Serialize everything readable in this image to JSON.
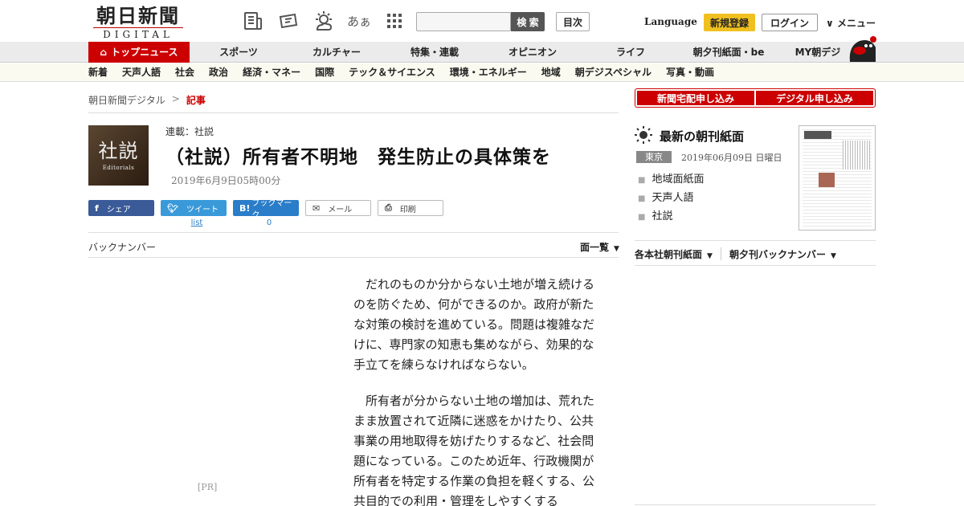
{
  "header": {
    "logo_main": "朝日新聞",
    "logo_sub": "DIGITAL",
    "search_label": "検 索",
    "toc_label": "目次",
    "language_label": "Language",
    "signup_label": "新規登録",
    "login_label": "ログイン",
    "menu_label": "メニュー",
    "icons": [
      "newspaper-icon",
      "ticket-icon",
      "weather-icon",
      "font-size-icon",
      "grid-icon"
    ],
    "font_icon_text": "あぁ"
  },
  "nav_main": [
    {
      "label": "トップニュース",
      "active": true
    },
    {
      "label": "スポーツ"
    },
    {
      "label": "カルチャー"
    },
    {
      "label": "特集・連載"
    },
    {
      "label": "オピニオン"
    },
    {
      "label": "ライフ"
    },
    {
      "label": "朝夕刊紙面・be"
    },
    {
      "label": "MY朝デジ"
    }
  ],
  "nav_sub": [
    "新着",
    "天声人語",
    "社会",
    "政治",
    "経済・マネー",
    "国際",
    "テック＆サイエンス",
    "環境・エネルギー",
    "地域",
    "朝デジスペシャル",
    "写真・動画"
  ],
  "breadcrumb": {
    "home": "朝日新聞デジタル",
    "sep": ">",
    "current": "記事"
  },
  "article": {
    "thumb_kanji": "社説",
    "thumb_en": "Editorials",
    "series": "連載：社説",
    "title": "（社説）所有者不明地　発生防止の具体策を",
    "date": "2019年6月9日05時00分",
    "paragraphs": [
      "だれのものか分からない土地が増え続けるのを防ぐため、何ができるのか。政府が新たな対策の検討を進めている。問題は複雑なだけに、専門家の知恵も集めながら、効果的な手立てを練らなければならない。",
      "所有者が分からない土地の増加は、荒れたまま放置されて近隣に迷惑をかけたり、公共事業の用地取得を妨げたりするなど、社会問題になっている。このため近年、行政機関が所有者を特定する作業の負担を軽くする、公共目的での利用・管理をしやすくする"
    ]
  },
  "share": {
    "facebook": "シェア",
    "twitter": "ツイート",
    "hatena": "ブックマーク",
    "mail": "メール",
    "print": "印刷",
    "twitter_count": "list",
    "hatena_count": "0"
  },
  "backnumber_label": "バックナンバー",
  "allpages_label": "面一覧",
  "pr_label": "[PR]",
  "sidebar": {
    "delivery_label": "新聞宅配申し込み",
    "digital_label": "デジタル申し込み",
    "paper_title": "最新の朝刊紙面",
    "edition": "東京",
    "paper_date": "2019年06月09日 日曜日",
    "links": [
      "地域面紙面",
      "天声人語",
      "社説"
    ],
    "regional_label": "各本社朝刊紙面",
    "evening_label": "朝夕刊バックナンバー"
  },
  "colors": {
    "brand_red": "#cc0000",
    "signup_yellow": "#f0c020",
    "facebook": "#3a5a98",
    "twitter": "#3a9ad9",
    "hatena": "#2a7dc8"
  }
}
